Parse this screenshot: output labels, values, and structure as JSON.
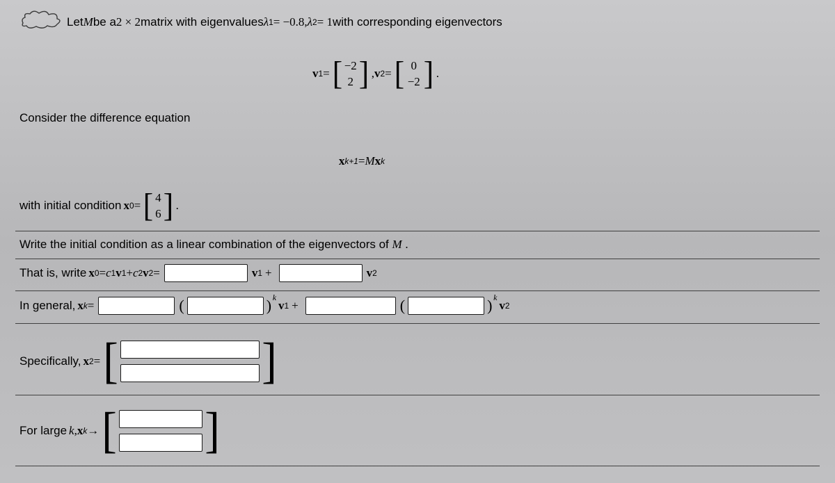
{
  "p1_a": "Let ",
  "p1_b": "M",
  "p1_c": " be a ",
  "p1_d": "2 × 2",
  "p1_e": " matrix with eigenvalues ",
  "p1_f": "λ",
  "p1_g": "1",
  "p1_h": " = −0.8,  ",
  "p1_i": "λ",
  "p1_j": "2",
  "p1_k": " = 1",
  "p1_l": " with corresponding eigenvectors",
  "v1_label": "v",
  "v1_sub": "1",
  "eq": " = ",
  "v1_top": "−2",
  "v1_bot": "2",
  "comma": ", ",
  "v2_label": "v",
  "v2_sub": "2",
  "v2_top": "0",
  "v2_bot": "−2",
  "period": ".",
  "p2": "Consider the difference equation",
  "diff_lhs_a": "x",
  "diff_lhs_b": "k+1",
  "diff_mid": " = ",
  "diff_rhs_a": "M",
  "diff_rhs_b": "x",
  "diff_rhs_c": "k",
  "p3_a": "with initial condition ",
  "p3_b": "x",
  "p3_c": "0",
  "p3_d": " = ",
  "x0_top": "4",
  "x0_bot": "6",
  "p4_a": "Write the initial condition as a linear combination of the eigenvectors of ",
  "p4_b": "M",
  "p4_c": ".",
  "p5_a": "That is, write ",
  "p5_b": "x",
  "p5_c": "0",
  "p5_d": " = ",
  "p5_e": "c",
  "p5_f": "1",
  "p5_g": "v",
  "p5_h": "1",
  "p5_i": " + ",
  "p5_j": "c",
  "p5_k": "2",
  "p5_l": "v",
  "p5_m": "2",
  "p5_n": " = ",
  "p5_o": "v",
  "p5_p": "1",
  "p5_q": "+",
  "p5_r": "v",
  "p5_s": "2",
  "p6_a": "In general, ",
  "p6_b": "x",
  "p6_c": "k",
  "p6_d": " = ",
  "p6_lp": "(",
  "p6_rp": ")",
  "p6_k": "k",
  "p6_v1a": "v",
  "p6_v1b": "1",
  "p6_plus": "+",
  "p6_v2a": "v",
  "p6_v2b": "2",
  "p7_a": "Specifically, ",
  "p7_b": "x",
  "p7_c": "2",
  "p7_d": " = ",
  "p8_a": "For large ",
  "p8_b": "k",
  "p8_c": ", ",
  "p8_d": "x",
  "p8_e": "k",
  "p8_f": " → "
}
